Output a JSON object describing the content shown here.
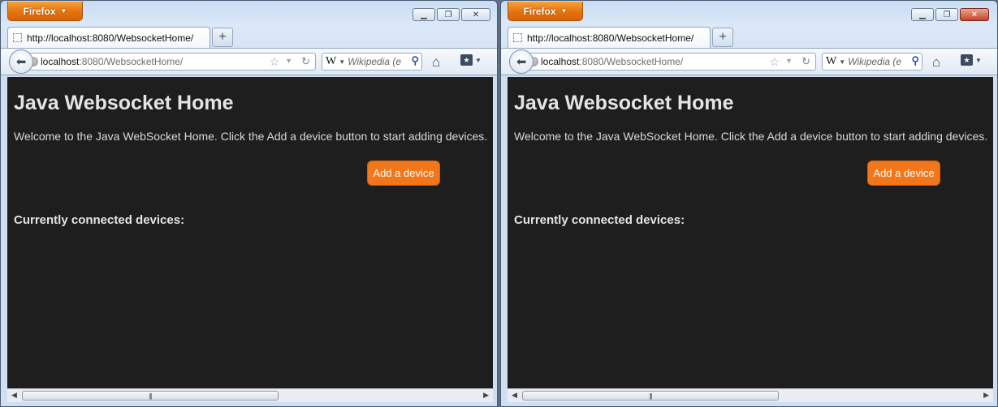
{
  "windows": [
    {
      "app_button": "Firefox",
      "tab": {
        "title": "http://localhost:8080/WebsocketHome/"
      },
      "url": {
        "host": "localhost",
        "path": ":8080/WebsocketHome/"
      },
      "search": {
        "engine_glyph": "W",
        "placeholder": "Wikipedia (en)"
      },
      "page": {
        "title": "Java Websocket Home",
        "welcome": "Welcome to the Java WebSocket Home. Click the Add a device button to start adding devices.",
        "add_button": "Add a device",
        "devices_heading": "Currently connected devices:"
      }
    },
    {
      "app_button": "Firefox",
      "tab": {
        "title": "http://localhost:8080/WebsocketHome/"
      },
      "url": {
        "host": "localhost",
        "path": ":8080/WebsocketHome/"
      },
      "search": {
        "engine_glyph": "W",
        "placeholder": "Wikipedia (en)"
      },
      "page": {
        "title": "Java Websocket Home",
        "welcome": "Welcome to the Java WebSocket Home. Click the Add a device button to start adding devices.",
        "add_button": "Add a device",
        "devices_heading": "Currently connected devices:"
      }
    }
  ],
  "theme": {
    "accent": "#f2771b",
    "page_background": "#1e1e1e",
    "firefox_button": "#e3730e"
  }
}
